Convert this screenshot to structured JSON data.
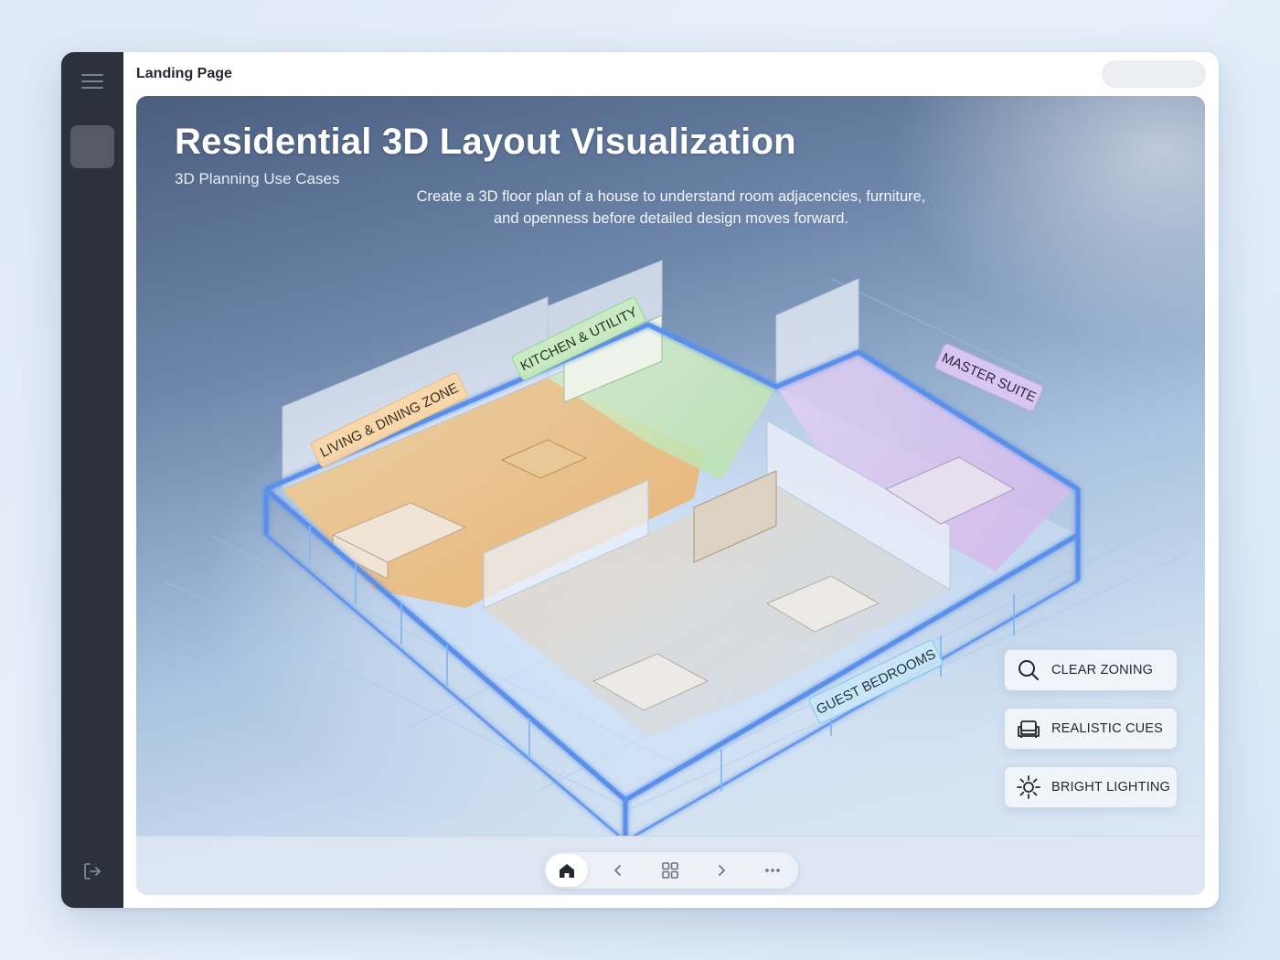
{
  "topbar": {
    "page_label": "Landing Page"
  },
  "hero": {
    "title": "Residential 3D Layout Visualization",
    "subtitle": "3D Planning Use Cases",
    "description": "Create a 3D floor plan of a house to understand room adjacencies, furniture, and openness before detailed design moves forward."
  },
  "zones": {
    "living": "LIVING & DINING ZONE",
    "kitchen": "KITCHEN & UTILITY",
    "master": "MASTER SUITE",
    "guest": "GUEST BEDROOMS"
  },
  "features": [
    {
      "label": "CLEAR ZONING",
      "icon": "magnifier-icon"
    },
    {
      "label": "REALISTIC CUES",
      "icon": "armchair-icon"
    },
    {
      "label": "BRIGHT LIGHTING",
      "icon": "sun-icon"
    }
  ],
  "bottom_nav": [
    "home-icon",
    "chevron-left-icon",
    "grid-icon",
    "chevron-right-icon",
    "more-icon"
  ],
  "colors": {
    "sidebar": "#2c323b",
    "living_zone": "#f2b366",
    "kitchen_zone": "#8fd68a",
    "master_zone": "#c3a6ee",
    "guest_zone": "#7fc4ef",
    "wall_glow": "#5b8fe8"
  }
}
